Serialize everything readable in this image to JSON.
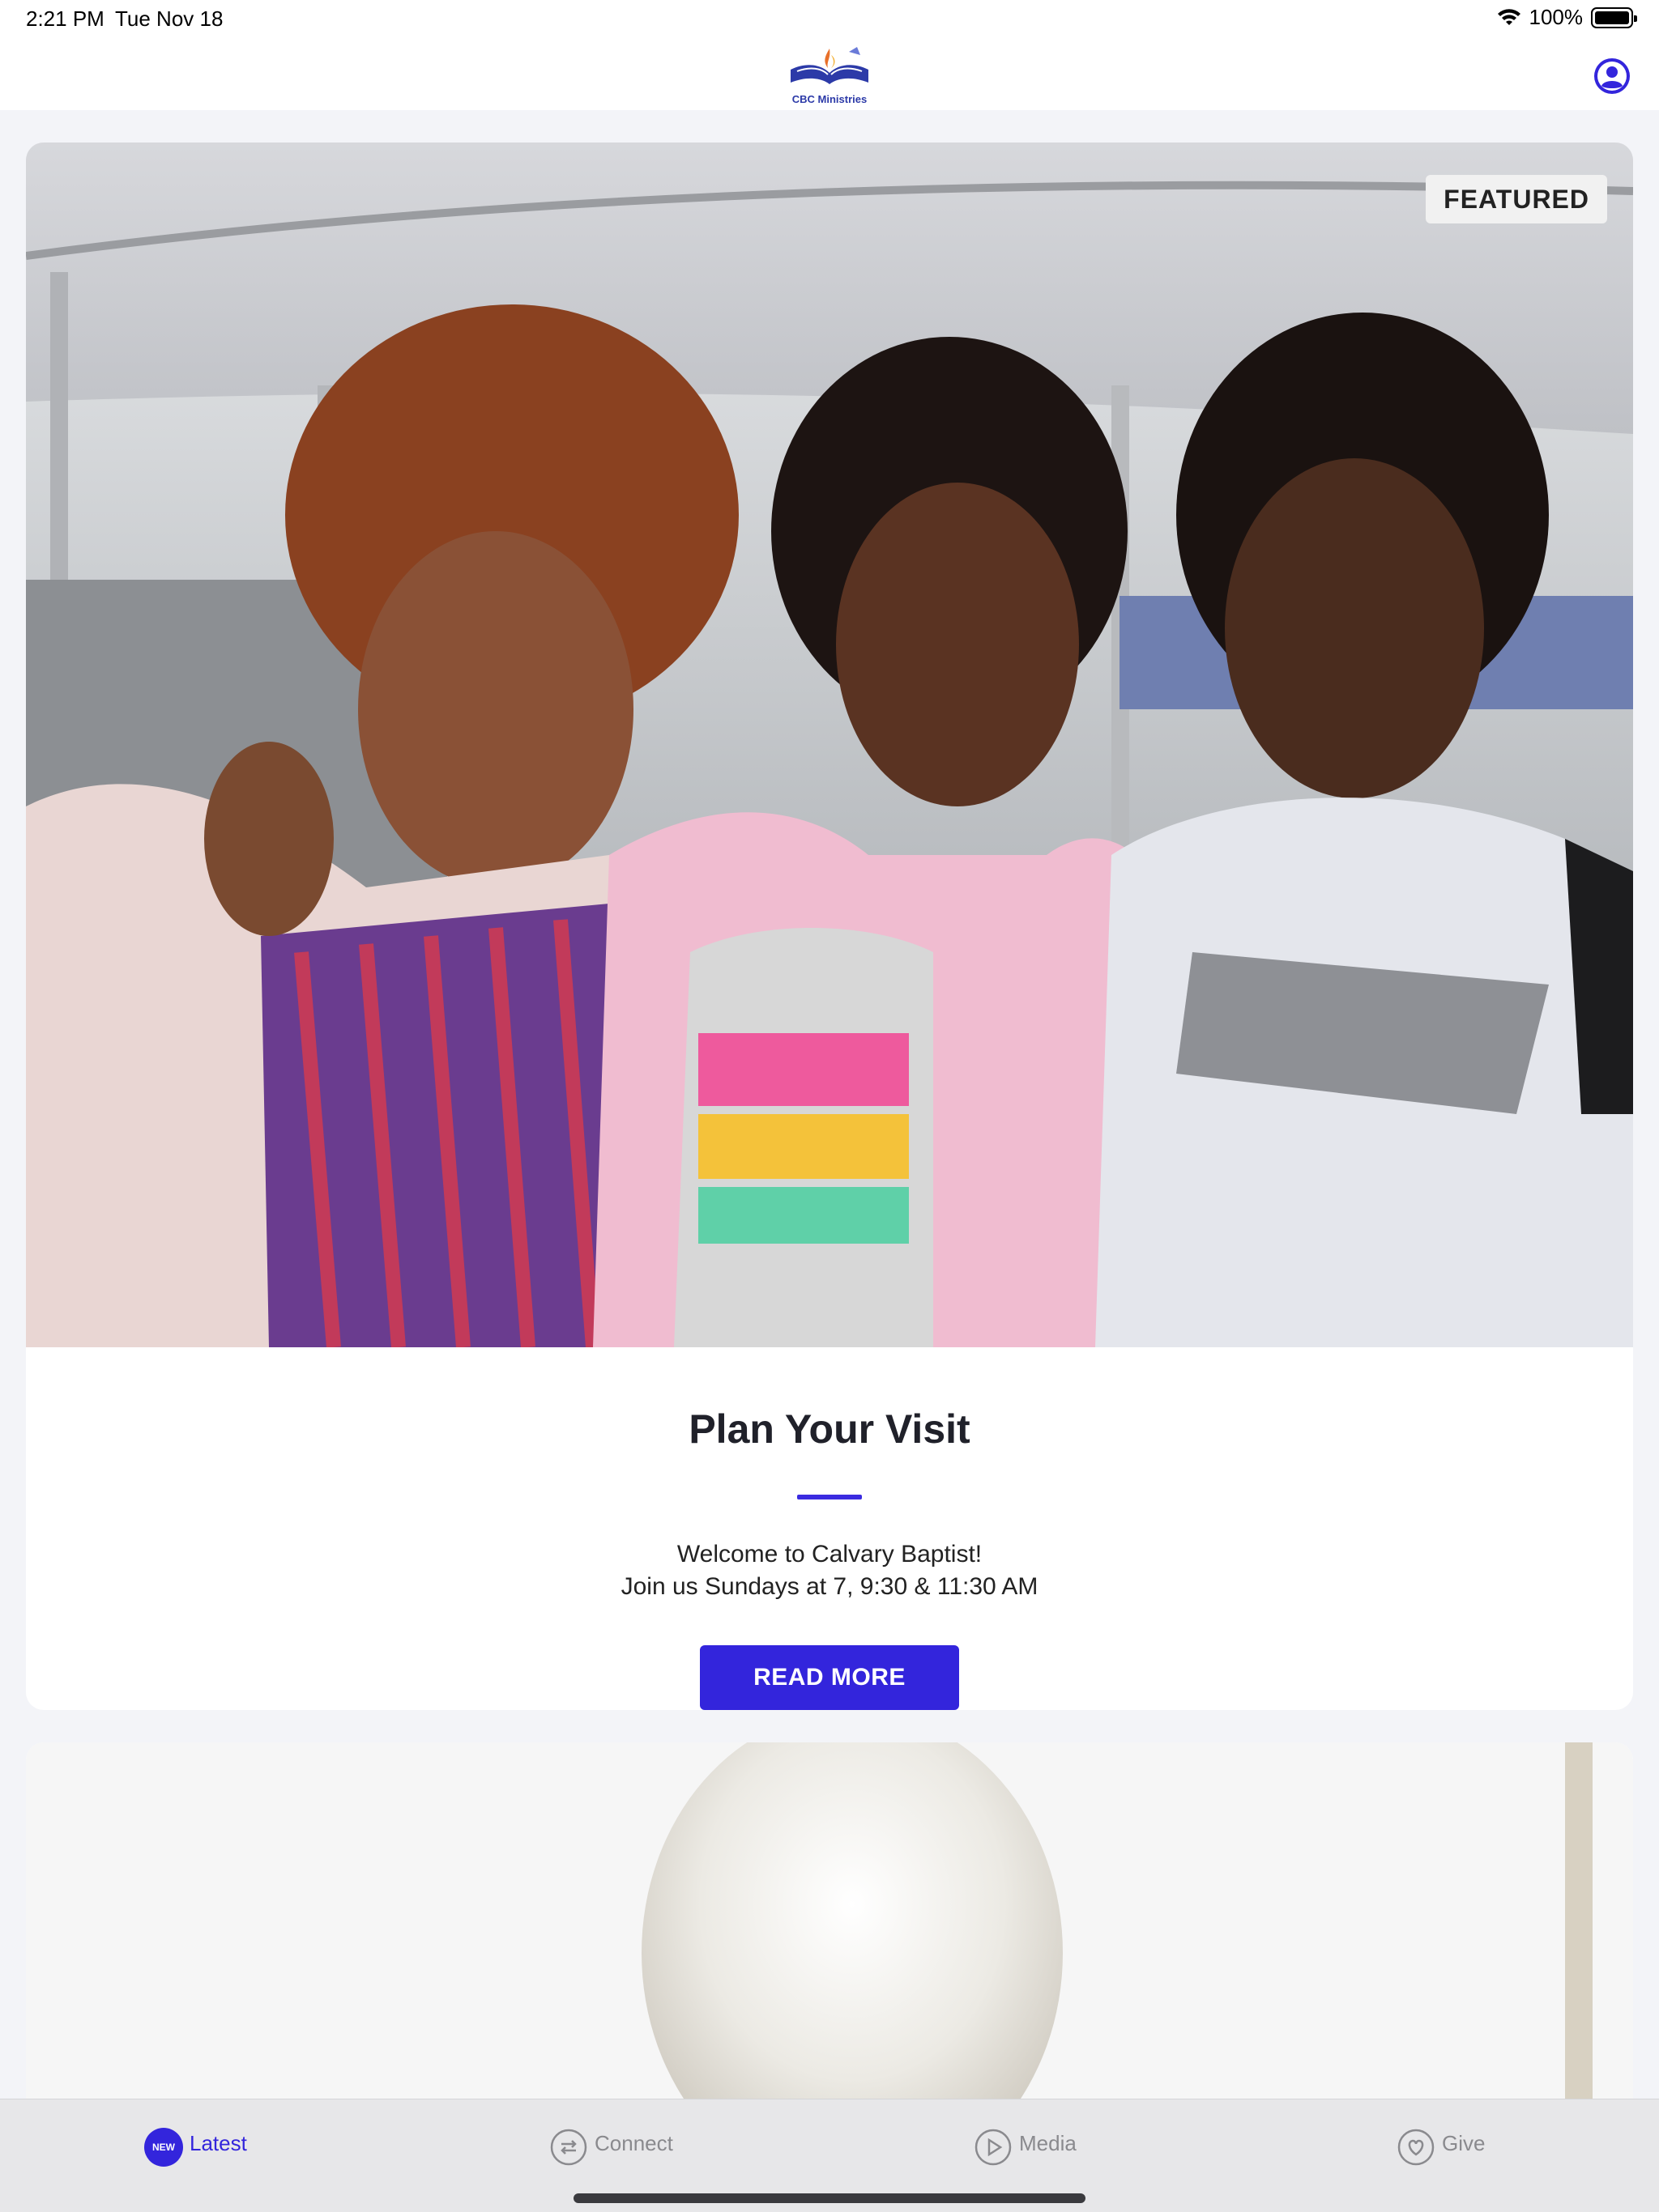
{
  "status_bar": {
    "time": "2:21 PM",
    "date": "Tue Nov 18",
    "battery": "100%",
    "icons": [
      "wifi-icon",
      "battery-icon"
    ]
  },
  "header": {
    "logo_text": "CBC Ministries",
    "profile_icon": "person-circle-icon",
    "accent_color": "#3325dc"
  },
  "feed": {
    "cards": [
      {
        "badge": "FEATURED",
        "title": "Plan Your Visit",
        "body_line1": "Welcome to Calvary Baptist!",
        "body_line2": "Join us Sundays at 7, 9:30 & 11:30 AM",
        "button_label": "READ MORE"
      }
    ]
  },
  "tabbar": {
    "tabs": [
      {
        "label": "Latest",
        "icon": "new-badge-icon",
        "badge": "NEW",
        "active": true
      },
      {
        "label": "Connect",
        "icon": "connect-arrows-icon",
        "active": false
      },
      {
        "label": "Media",
        "icon": "play-circle-icon",
        "active": false
      },
      {
        "label": "Give",
        "icon": "heart-circle-icon",
        "active": false
      }
    ]
  }
}
